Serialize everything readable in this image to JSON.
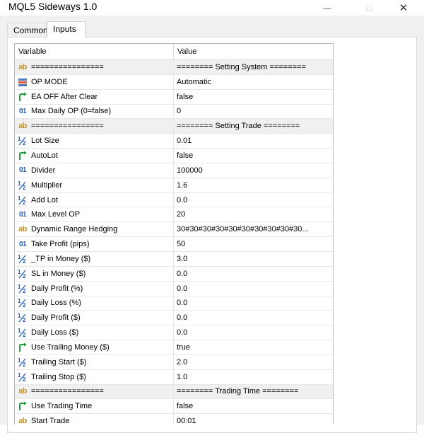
{
  "window": {
    "title": "MQL5 Sideways 1.0"
  },
  "tabs": [
    {
      "label": "Common"
    },
    {
      "label": "Inputs"
    }
  ],
  "grid": {
    "headers": {
      "variable": "Variable",
      "value": "Value"
    },
    "rows": [
      {
        "icon": "ab",
        "variable": "================",
        "value": "======== Setting System ========",
        "sep": true
      },
      {
        "icon": "enum",
        "variable": "OP MODE",
        "value": "Automatic"
      },
      {
        "icon": "bool",
        "variable": "EA OFF After Clear",
        "value": "false"
      },
      {
        "icon": "int",
        "variable": "Max Daily OP  (0=false)",
        "value": "0"
      },
      {
        "icon": "ab",
        "variable": "================",
        "value": "======== Setting Trade ========",
        "sep": true
      },
      {
        "icon": "half",
        "variable": "Lot Size",
        "value": "0.01"
      },
      {
        "icon": "bool",
        "variable": "AutoLot",
        "value": "false"
      },
      {
        "icon": "int",
        "variable": "Divider",
        "value": "100000"
      },
      {
        "icon": "half",
        "variable": "Multiplier",
        "value": "1.6"
      },
      {
        "icon": "half",
        "variable": "Add Lot",
        "value": "0.0"
      },
      {
        "icon": "int",
        "variable": "Max Level OP",
        "value": "20"
      },
      {
        "icon": "ab",
        "variable": "Dynamic Range Hedging",
        "value": "30#30#30#30#30#30#30#30#30#30..."
      },
      {
        "icon": "int",
        "variable": "Take Profit (pips)",
        "value": "50"
      },
      {
        "icon": "half",
        "variable": "_TP in Money ($)",
        "value": "3.0"
      },
      {
        "icon": "half",
        "variable": "SL in Money ($)",
        "value": "0.0"
      },
      {
        "icon": "half",
        "variable": "Daily Profit (%)",
        "value": "0.0"
      },
      {
        "icon": "half",
        "variable": "Daily Loss (%)",
        "value": "0.0"
      },
      {
        "icon": "half",
        "variable": "Daily Profit ($)",
        "value": "0.0"
      },
      {
        "icon": "half",
        "variable": "Daily Loss ($)",
        "value": "0.0"
      },
      {
        "icon": "bool",
        "variable": "Use Trailing Money ($)",
        "value": "true"
      },
      {
        "icon": "half",
        "variable": "Trailing Start ($)",
        "value": "2.0"
      },
      {
        "icon": "half",
        "variable": "Trailing Stop ($)",
        "value": "1.0"
      },
      {
        "icon": "ab",
        "variable": "================",
        "value": "======== Trading Time ========",
        "sep": true
      },
      {
        "icon": "bool",
        "variable": "Use Trading Time",
        "value": "false"
      },
      {
        "icon": "ab",
        "variable": "Start Trade",
        "value": "00:01"
      }
    ]
  },
  "icon_colors": {
    "ab": "#c8952c",
    "int": "#1f5fbf",
    "half": "#1f5fbf",
    "bool": "#1e9e3a",
    "enum": "#4a78c2"
  }
}
